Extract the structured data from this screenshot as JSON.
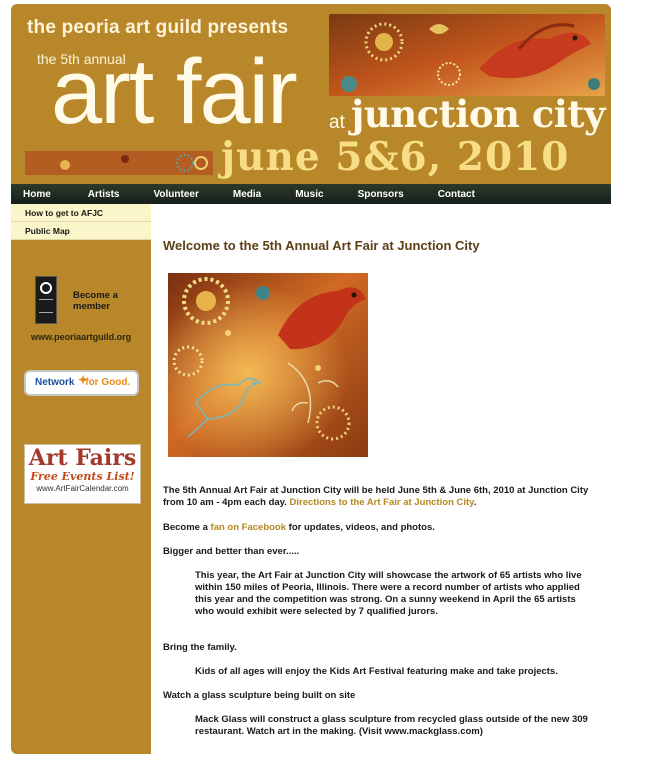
{
  "banner": {
    "presents": "the peoria art guild presents",
    "annual": "the 5th annual",
    "title": "art fair",
    "at": "at",
    "location": "junction city",
    "dates": "june 5&6, 2010"
  },
  "nav": [
    "Home",
    "Artists",
    "Volunteer",
    "Media",
    "Music",
    "Sponsors",
    "Contact"
  ],
  "sidebar": {
    "links": [
      "How to get to AFJC",
      "Public Map"
    ],
    "member_badge_text": "Become a member",
    "guild_url": "www.peoriaartguild.org",
    "network_badge": {
      "network": "Network",
      "for_good": "for Good."
    },
    "artfairs_badge": {
      "title": "Art Fairs",
      "subtitle": "Free Events List!",
      "url": "www.ArtFairCalendar.com"
    }
  },
  "main": {
    "title": "Welcome to the 5th Annual Art Fair at Junction City",
    "intro_text": "The 5th Annual Art Fair at Junction City will be held June 5th & June 6th, 2010 at Junction City from 10 am - 4pm each day.",
    "intro_link": "Directions to the Art Fair at Junction City",
    "intro_end": ".",
    "facebook_pre": "Become a",
    "facebook_link": "fan on Facebook",
    "facebook_post": "for updates, videos, and photos.",
    "bigger_heading": "Bigger and better than ever.....",
    "bigger_text": "This year, the Art Fair at Junction City will showcase the artwork of 65 artists who live within 150 miles of Peoria, Illinois. There were a record number of artists who applied this year and the competition was strong. On a sunny weekend in April the 65 artists who would exhibit were selected by 7 qualified jurors.",
    "family_heading": "Bring the family.",
    "family_text": "Kids of all ages will enjoy the Kids Art Festival featuring make and take projects.",
    "glass_heading": "Watch a glass sculpture being built on site",
    "glass_text": "Mack Glass will construct a glass sculpture from recycled glass outside of the new 309 restaurant. Watch art in the making. (Visit www.mackglass.com)"
  }
}
